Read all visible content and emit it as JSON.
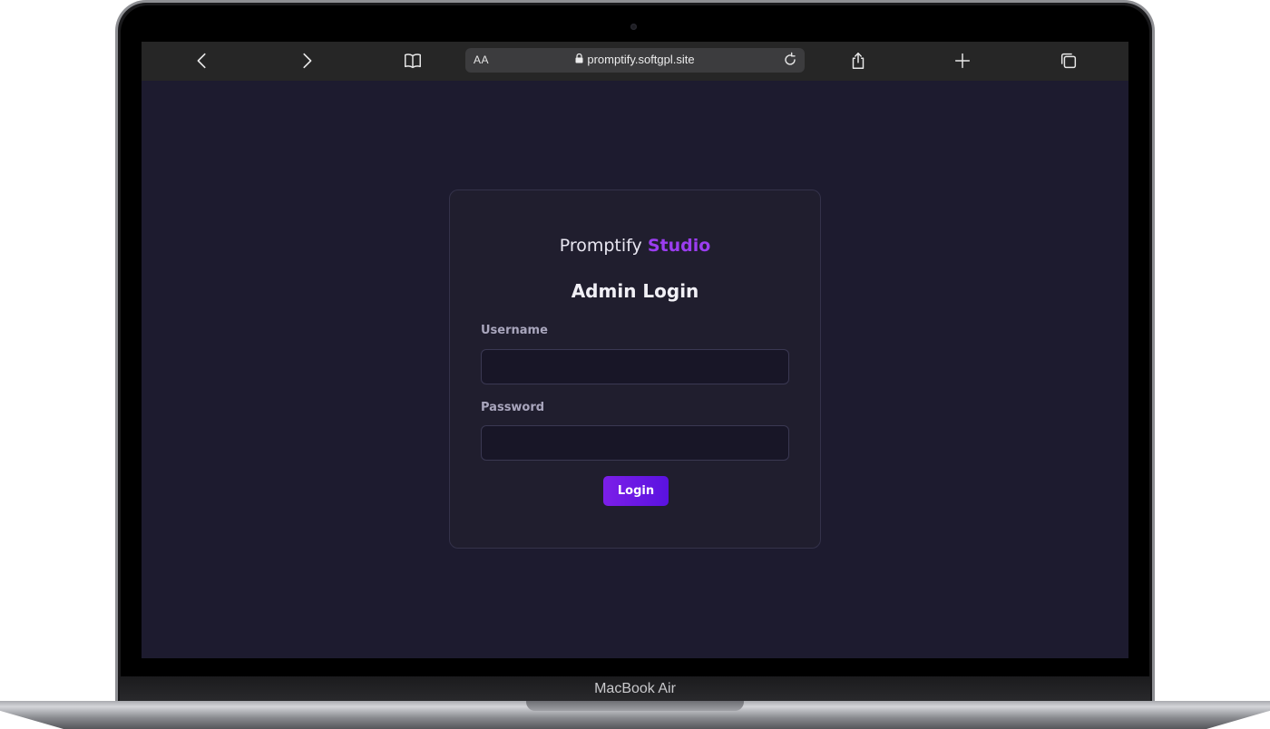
{
  "browser": {
    "text_size_label": "AA",
    "url": "promptify.softgpl.site",
    "icons": {
      "back": "chevron-left-icon",
      "forward": "chevron-right-icon",
      "bookmarks": "book-icon",
      "lock": "lock-icon",
      "reload": "reload-icon",
      "share": "share-icon",
      "new_tab": "plus-icon",
      "tabs": "tabs-icon"
    }
  },
  "login": {
    "brand_name": "Promptify",
    "brand_accent": "Studio",
    "title": "Admin Login",
    "username_label": "Username",
    "username_value": "",
    "password_label": "Password",
    "password_value": "",
    "login_button": "Login"
  },
  "device": {
    "model": "MacBook Air"
  },
  "colors": {
    "page_background": "#1d1b2f",
    "card_background": "#201e2e",
    "accent": "#9b3df0",
    "button_gradient_start": "#7c1fe8",
    "button_gradient_end": "#5a12e0"
  }
}
